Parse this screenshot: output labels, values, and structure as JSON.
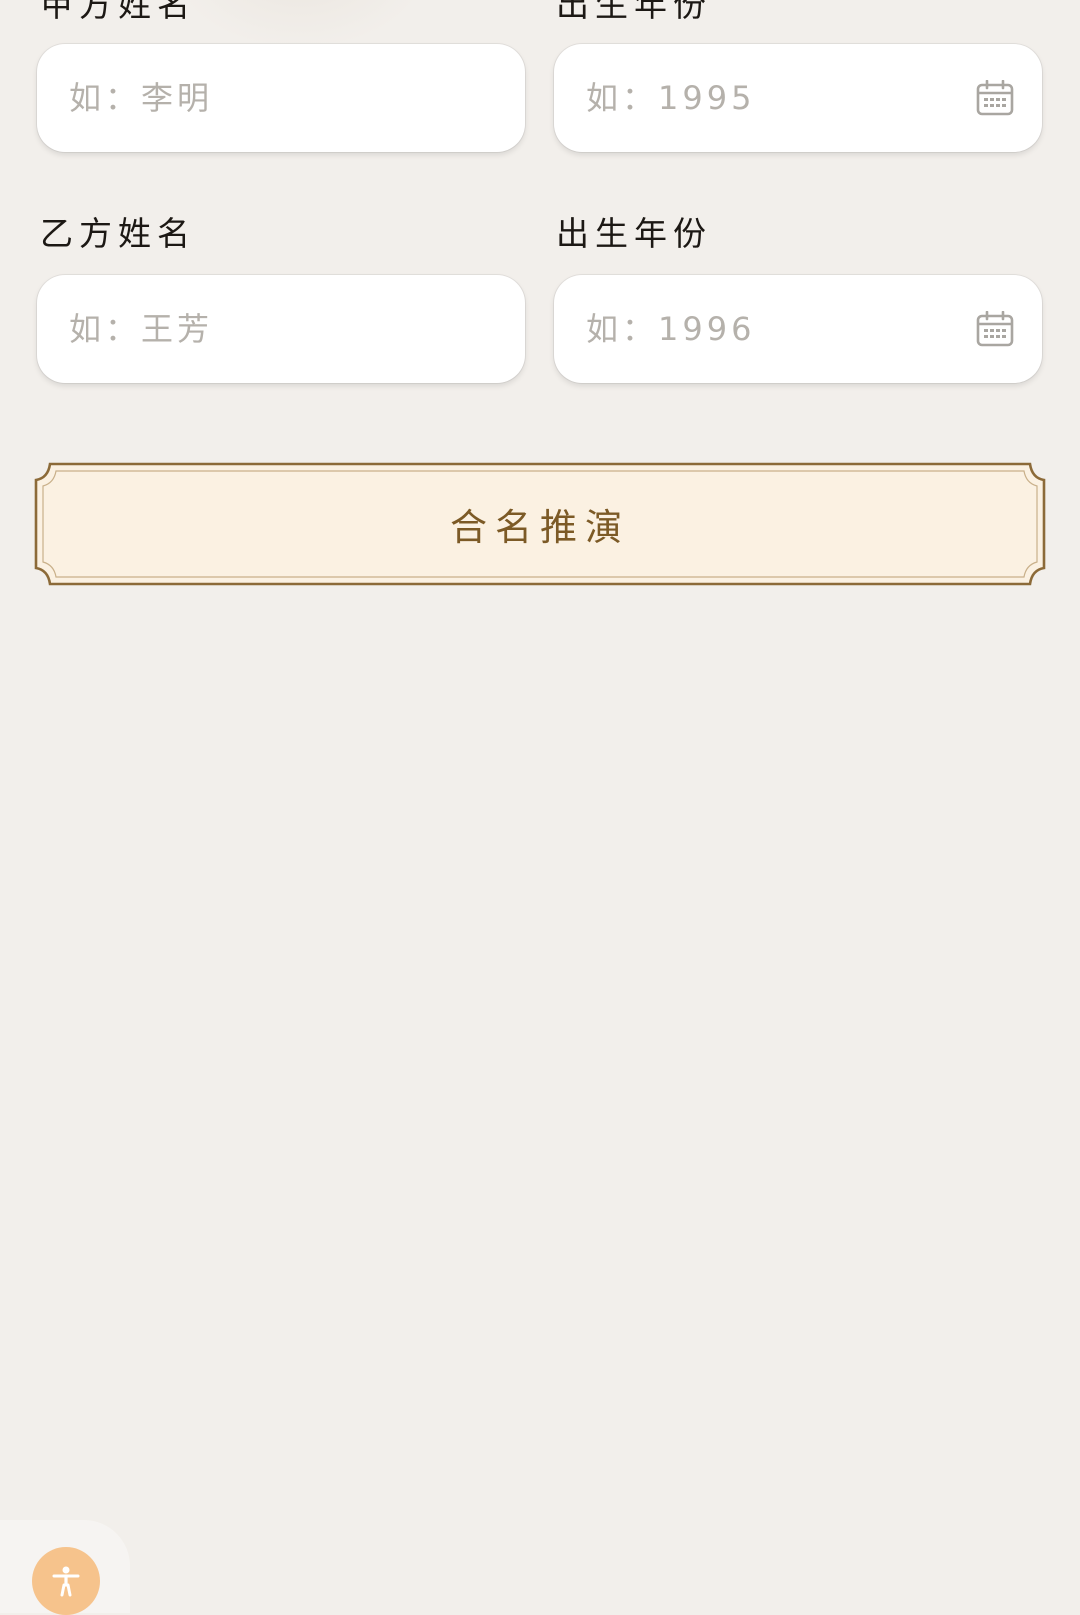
{
  "form": {
    "party_a": {
      "name_label": "甲方姓名",
      "name_placeholder": "如：李明",
      "year_label": "出生年份",
      "year_placeholder": "如：1995"
    },
    "party_b": {
      "name_label": "乙方姓名",
      "name_placeholder": "如：王芳",
      "year_label": "出生年份",
      "year_placeholder": "如：1996"
    },
    "submit_label": "合名推演"
  },
  "icons": {
    "year_picker": "calendar-icon",
    "accessibility": "accessibility-person-icon"
  },
  "colors": {
    "background": "#f2efeb",
    "button_fill": "#fbf1e2",
    "button_border": "#8c6a38",
    "button_text": "#7c5a26",
    "accessibility_button": "#f6c38c",
    "placeholder": "#b5b1ab"
  }
}
